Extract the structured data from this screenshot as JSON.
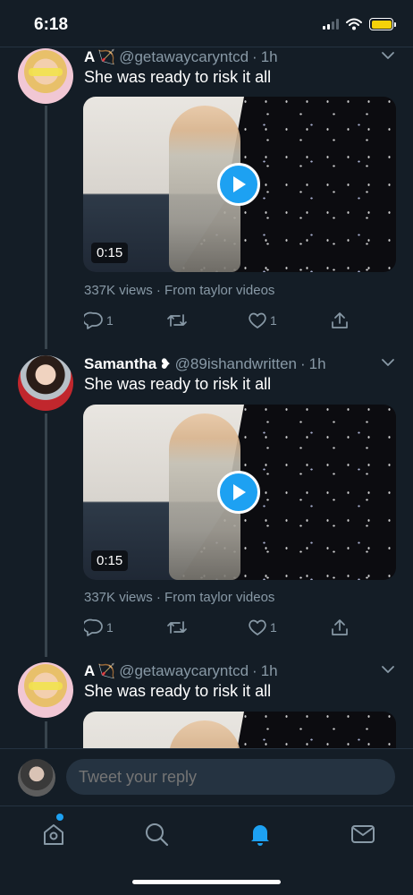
{
  "status_bar": {
    "time": "6:18"
  },
  "tweets": [
    {
      "name": "A",
      "name_emoji": "🏹",
      "handle": "@getawaycaryntcd",
      "dot": "·",
      "time": "1h",
      "text": "She was ready to risk it all",
      "duration": "0:15",
      "meta": "337K views · From taylor videos",
      "replies": "1",
      "retweets": "",
      "likes": "1"
    },
    {
      "name": "Samantha",
      "name_emoji": "❥",
      "handle": "@89ishandwritten",
      "dot": "·",
      "time": "1h",
      "text": "She was ready to risk it all",
      "duration": "0:15",
      "meta": "337K views · From taylor videos",
      "replies": "1",
      "retweets": "",
      "likes": "1"
    },
    {
      "name": "A",
      "name_emoji": "🏹",
      "handle": "@getawaycaryntcd",
      "dot": "·",
      "time": "1h",
      "text": "She was ready to risk it all"
    }
  ],
  "reply_bar": {
    "placeholder": "Tweet your reply"
  },
  "nav": {
    "items": [
      "home-icon",
      "search-icon",
      "notifications-icon",
      "messages-icon"
    ]
  },
  "colors": {
    "background": "#141d26",
    "accent": "#1da1f2",
    "muted": "#8899a6",
    "divider": "#253341"
  }
}
